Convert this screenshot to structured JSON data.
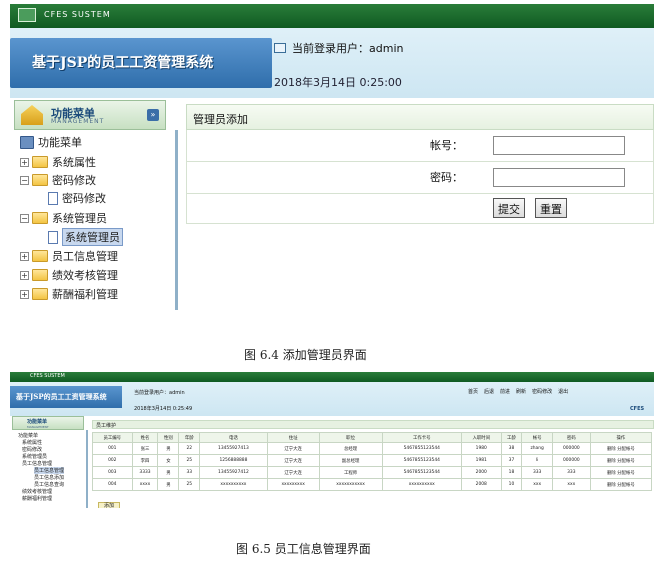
{
  "screen1": {
    "window_title": "CFES SUSTEM",
    "banner_title": "基于JSP的员工工资管理系统",
    "current_user_label": "当前登录用户：admin",
    "datetime": "2018年3月14日  0:25:00",
    "menu_title": "功能菜单",
    "menu_subtitle": "MANAGEMENT",
    "tree": {
      "root": "功能菜单",
      "items": [
        {
          "label": "系统属性"
        },
        {
          "label": "密码修改"
        },
        {
          "label": "密码修改"
        },
        {
          "label": "系统管理员"
        },
        {
          "label": "系统管理员"
        },
        {
          "label": "员工信息管理"
        },
        {
          "label": "绩效考核管理"
        },
        {
          "label": "薪酬福利管理"
        }
      ]
    },
    "form": {
      "title": "管理员添加",
      "account_label": "帐号：",
      "password_label": "密码：",
      "submit": "提交",
      "reset": "重置"
    }
  },
  "caption1": "图 6.4 添加管理员界面",
  "screen2": {
    "window_title": "CFES SUSTEM",
    "banner_title": "基于JSP的员工工资管理系统",
    "current_user_label": "当前登录用户：admin",
    "datetime": "2018年3月14日  0:25:49",
    "toolbar": [
      "首页",
      "后退",
      "前进",
      "刷新",
      "密码修改",
      "退出"
    ],
    "brand": "CFES",
    "menu_title": "功能菜单",
    "menu_subtitle": "MANAGEMENT",
    "tree": [
      "功能菜单",
      "系统属性",
      "密码修改",
      "系统管理员",
      "员工信息管理",
      "员工信息管理",
      "员工信息添加",
      "员工信息查询",
      "绩效考核管理",
      "薪酬福利管理"
    ],
    "section_title": "员工维护",
    "table": {
      "headers": [
        "员工编号",
        "姓名",
        "性别",
        "年龄",
        "电话",
        "住址",
        "职位",
        "工作卡号",
        "入职时间",
        "工龄",
        "帐号",
        "密码",
        "操作"
      ],
      "rows": [
        [
          "001",
          "张三",
          "男",
          "22",
          "13455927413",
          "辽宁大连",
          "总经理",
          "5467855123544",
          "1980",
          "38",
          "zhang",
          "000000",
          "删除 分配帐号"
        ],
        [
          "002",
          "李四",
          "女",
          "25",
          "1256888888",
          "辽宁大连",
          "副总经理",
          "5467855123544",
          "1981",
          "37",
          "li",
          "000000",
          "删除 分配帐号"
        ],
        [
          "003",
          "3333",
          "男",
          "33",
          "13455927412",
          "辽宁大连",
          "工程师",
          "5467855123544",
          "2000",
          "18",
          "333",
          "333",
          "删除 分配帐号"
        ],
        [
          "004",
          "xxxx",
          "男",
          "25",
          "xxxxxxxxxx",
          "xxxxxxxxx",
          "xxxxxxxxxxx",
          "xxxxxxxxxx",
          "2008",
          "10",
          "xxx",
          "xxx",
          "删除 分配帐号"
        ]
      ]
    },
    "add_button": "添加"
  },
  "caption2": "图 6.5 员工信息管理界面"
}
